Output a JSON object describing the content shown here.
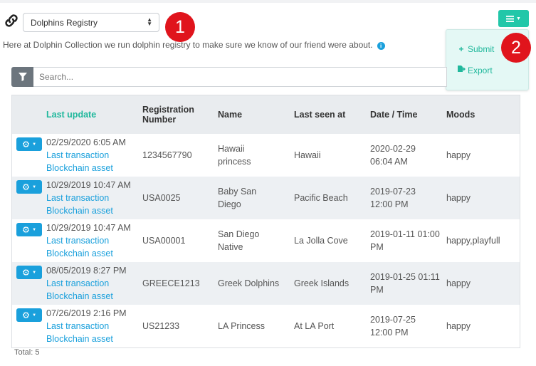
{
  "header": {
    "registry_select": {
      "selected": "Dolphins Registry"
    },
    "description": "Here at Dolphin Collection we run dolphin registry to make sure we know of our friend were about.",
    "callouts": [
      "1",
      "2"
    ]
  },
  "menu": {
    "items": [
      {
        "label": "Submit",
        "icon": "plus-icon"
      },
      {
        "label": "Export",
        "icon": "export-icon"
      }
    ]
  },
  "search": {
    "placeholder": "Search..."
  },
  "table": {
    "columns": {
      "last_update": "Last update",
      "registration_1": "Registration",
      "registration_2": "Number",
      "name": "Name",
      "last_seen": "Last seen at",
      "date_time": "Date / Time",
      "moods": "Moods"
    },
    "rows": [
      {
        "last_update": "02/29/2020 6:05 AM",
        "link1": "Last transaction",
        "link2": "Blockchain asset",
        "registration": "1234567790",
        "name_1": "Hawaii",
        "name_2": "princess",
        "last_seen": "Hawaii",
        "date_1": "2020-02-29",
        "date_2": "06:04 AM",
        "moods": "happy"
      },
      {
        "last_update": "10/29/2019 10:47 AM",
        "link1": "Last transaction",
        "link2": "Blockchain asset",
        "registration": "USA0025",
        "name_1": "Baby San",
        "name_2": "Diego",
        "last_seen": "Pacific Beach",
        "date_1": "2019-07-23",
        "date_2": "12:00 PM",
        "moods": "happy"
      },
      {
        "last_update": "10/29/2019 10:47 AM",
        "link1": "Last transaction",
        "link2": "Blockchain asset",
        "registration": "USA00001",
        "name_1": "San Diego",
        "name_2": "Native",
        "last_seen": "La Jolla Cove",
        "date_1": "2019-01-11 01:00",
        "date_2": "PM",
        "moods": "happy,playfull"
      },
      {
        "last_update": "08/05/2019 8:27 PM",
        "link1": "Last transaction",
        "link2": "Blockchain asset",
        "registration": "GREECE1213",
        "name_1": "Greek Dolphins",
        "name_2": "",
        "last_seen": "Greek Islands",
        "date_1": "2019-01-25 01:11",
        "date_2": "PM",
        "moods": "happy"
      },
      {
        "last_update": "07/26/2019 2:16 PM",
        "link1": "Last transaction",
        "link2": "Blockchain asset",
        "registration": "US21233",
        "name_1": "LA Princess",
        "name_2": "",
        "last_seen": "At LA Port",
        "date_1": "2019-07-25",
        "date_2": "12:00 PM",
        "moods": "happy"
      }
    ]
  },
  "footer": {
    "total": "Total: 5"
  },
  "colors": {
    "accent": "#22c7a9",
    "link": "#1aa0dc",
    "callout": "#e0141c"
  }
}
